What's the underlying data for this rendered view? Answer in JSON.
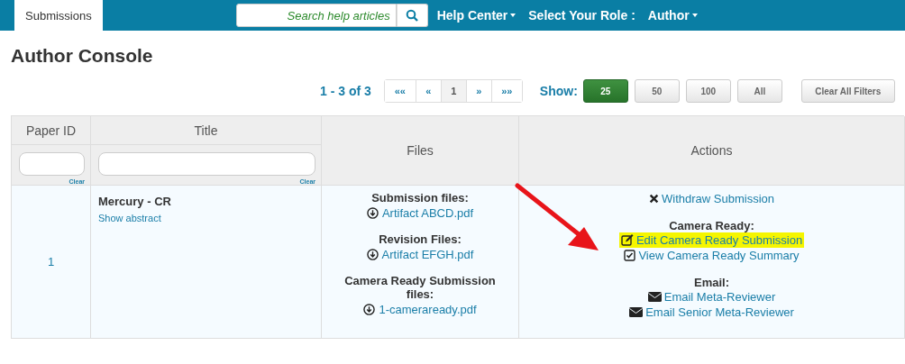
{
  "navbar": {
    "tab": "Submissions",
    "search": {
      "placeholder": "Search help articles"
    },
    "menus": [
      {
        "label": "Help Center",
        "dropdown": true
      },
      {
        "label": "Select Your Role :",
        "dropdown": false
      },
      {
        "label": "Author",
        "dropdown": true
      }
    ]
  },
  "page_title": "Author Console",
  "pagination": {
    "summary": "1 - 3 of 3",
    "pages": [
      {
        "label": "««",
        "selected": false
      },
      {
        "label": "«",
        "selected": false
      },
      {
        "label": "1",
        "selected": true
      },
      {
        "label": "»",
        "selected": false
      },
      {
        "label": "»»",
        "selected": false
      }
    ]
  },
  "show": {
    "label": "Show:",
    "options": [
      {
        "label": "25",
        "selected": true
      },
      {
        "label": "50",
        "selected": false
      },
      {
        "label": "100",
        "selected": false
      },
      {
        "label": "All",
        "selected": false
      }
    ]
  },
  "clear_all": "Clear All Filters",
  "table": {
    "columns": [
      {
        "label": "Paper ID",
        "filter": true,
        "clear": "Clear"
      },
      {
        "label": "Title",
        "filter": true,
        "clear": "Clear"
      },
      {
        "label": "Files",
        "filter": false
      },
      {
        "label": "Actions",
        "filter": false
      }
    ],
    "rows": [
      {
        "paper_id": "1",
        "title": "Mercury - CR",
        "show_abstract": "Show abstract",
        "files": [
          {
            "heading": "Submission files:",
            "file": "Artifact ABCD.pdf"
          },
          {
            "heading": "Revision Files:",
            "file": "Artifact EFGH.pdf"
          },
          {
            "heading": "Camera Ready Submission files:",
            "file": "1-cameraready.pdf"
          }
        ],
        "actions": [
          {
            "links": [
              {
                "kind": "withdraw",
                "label": "Withdraw Submission",
                "highlighted": false
              }
            ]
          },
          {
            "heading": "Camera Ready:",
            "links": [
              {
                "kind": "edit",
                "label": "Edit Camera Ready Submission",
                "highlighted": true
              },
              {
                "kind": "view",
                "label": "View Camera Ready Summary",
                "highlighted": false
              }
            ]
          },
          {
            "heading": "Email:",
            "links": [
              {
                "kind": "email",
                "label": "Email Meta-Reviewer",
                "highlighted": false
              },
              {
                "kind": "email",
                "label": "Email Senior Meta-Reviewer",
                "highlighted": false
              }
            ],
            "stacked": true
          }
        ]
      }
    ]
  },
  "annotation": {
    "kind": "arrow"
  }
}
